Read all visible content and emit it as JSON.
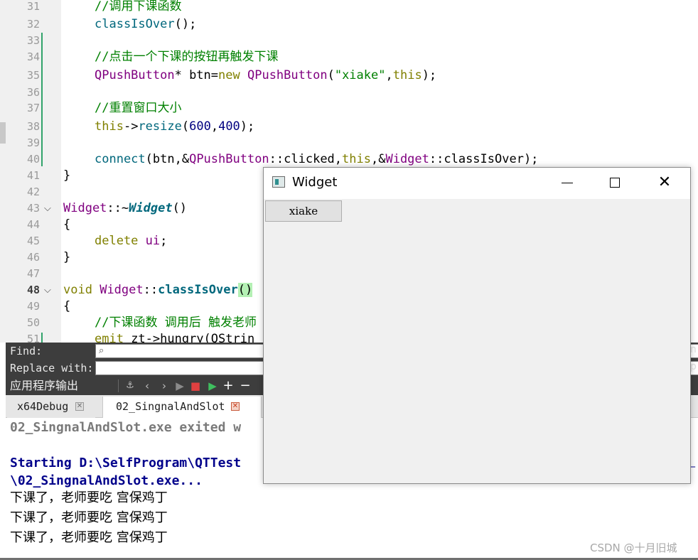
{
  "editor": {
    "lines": [
      {
        "n": "31",
        "html_id": "l31"
      },
      {
        "n": "32",
        "html_id": "l32"
      }
    ],
    "line_numbers": [
      "31",
      "32",
      "33",
      "34",
      "35",
      "36",
      "37",
      "38",
      "39",
      "40",
      "41",
      "42",
      "43",
      "44",
      "45",
      "46",
      "47",
      "48",
      "49",
      "50",
      "51"
    ],
    "code": {
      "l31": "//调用下课函数",
      "l32_fn": "classIsOver",
      "l32_rest": "();",
      "l34": "//点击一个下课的按钮再触发下课",
      "l35_type": "QPushButton",
      "l35_a": "* btn=",
      "l35_kw": "new",
      "l35_sp": " ",
      "l35_type2": "QPushButton",
      "l35_p": "(",
      "l35_str": "\"xiake\"",
      "l35_c": ",",
      "l35_this": "this",
      "l35_end": ");",
      "l37": "//重置窗口大小",
      "l38_this": "this",
      "l38_arrow": "->",
      "l38_fn": "resize",
      "l38_p": "(",
      "l38_n1": "600",
      "l38_c": ",",
      "l38_n2": "400",
      "l38_end": ");",
      "l40_fn": "connect",
      "l40_a": "(btn,&",
      "l40_type": "QPushButton",
      "l40_b": "::clicked,",
      "l40_this": "this",
      "l40_c": ",&",
      "l40_type2": "Widget",
      "l40_d": "::classIsOver);",
      "l41": "}",
      "l43_type": "Widget",
      "l43_a": "::~",
      "l43_fn": "Widget",
      "l43_end": "()",
      "l44": "{",
      "l45_kw": "delete",
      "l45_sp": " ",
      "l45_ui": "ui",
      "l45_end": ";",
      "l46": "}",
      "l48_kw": "void",
      "l48_sp": " ",
      "l48_type": "Widget",
      "l48_a": "::",
      "l48_fn": "classIsOver",
      "l48_hl": "()",
      "l49": "{",
      "l50": "//下课函数 调用后 触发老师",
      "l51_kw": "emit",
      "l51_a": " zt->hungry(QStrin"
    }
  },
  "find_bar": {
    "find_label": "Find:",
    "replace_label": "Replace with:",
    "find_placeholder_icon": "search-icon",
    "right_clip_1": "n",
    "right_clip_2": "p"
  },
  "output_pane": {
    "title": "应用程序输出",
    "toolbar_icons": [
      "attach-icon",
      "chevron-left-icon",
      "chevron-right-icon",
      "run-icon",
      "stop-icon",
      "debug-run-icon",
      "plus-icon",
      "minus-icon"
    ],
    "tabs": [
      {
        "label": "x64Debug"
      },
      {
        "label": "02_SingnalAndSlot"
      }
    ],
    "lines": [
      {
        "text": "02_SingnalAndSlot.exe exited w",
        "style": "gray"
      },
      {
        "text": "",
        "style": "blank"
      },
      {
        "text": "Starting D:\\SelfProgram\\QTTest",
        "style": "blue"
      },
      {
        "text": "\\02_SingnalAndSlot.exe...",
        "style": "blue"
      },
      {
        "text": "下课了，老师要吃 宫保鸡丁",
        "style": "black"
      },
      {
        "text": "下课了，老师要吃 宫保鸡丁",
        "style": "black"
      },
      {
        "text": "下课了，老师要吃 宫保鸡丁",
        "style": "black"
      }
    ],
    "right_clip": "_"
  },
  "widget_window": {
    "title": "Widget",
    "button_label": "xiake",
    "controls": {
      "minimize": "minimize-icon",
      "maximize": "maximize-icon",
      "close": "close-icon"
    }
  },
  "watermark": "CSDN @十月旧城",
  "colors": {
    "comment": "#008000",
    "keyword": "#808000",
    "type": "#800080",
    "function": "#00677c",
    "number": "#000080",
    "output_blue": "#00008b",
    "dark_bar": "#3d3d3d",
    "change_bar": "#31a36b"
  }
}
